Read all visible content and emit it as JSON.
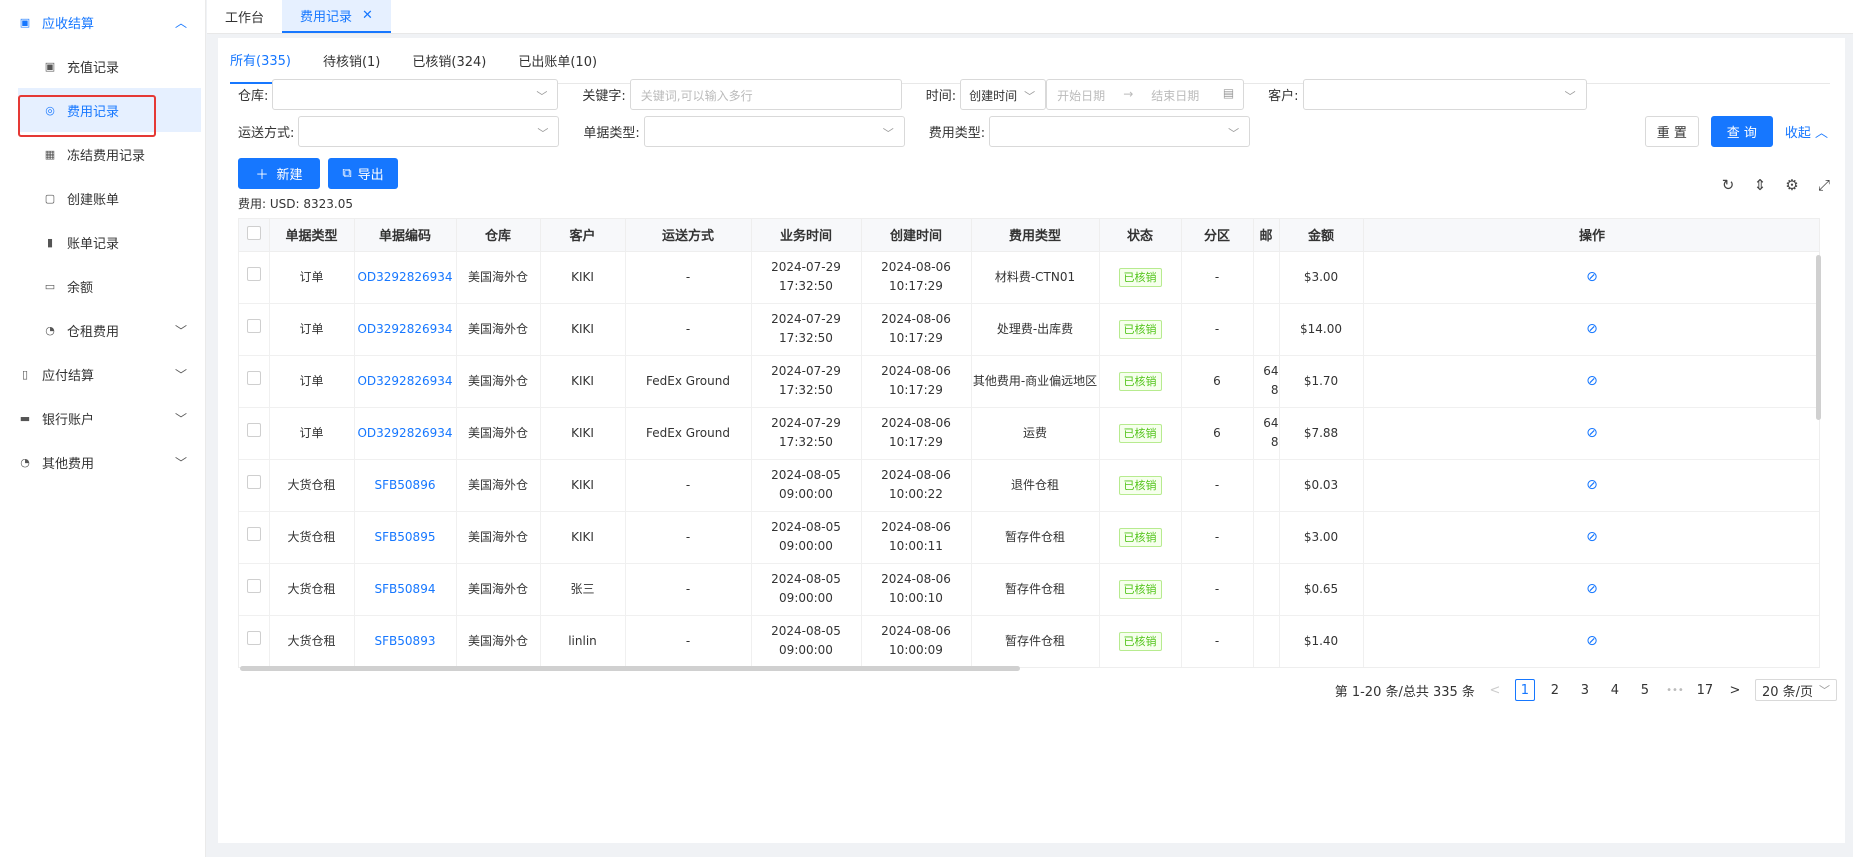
{
  "sidebar": {
    "group1": {
      "label": "应收结算",
      "icon": "ticket-icon"
    },
    "items": [
      {
        "label": "充值记录",
        "icon": "wallet-icon"
      },
      {
        "label": "费用记录",
        "icon": "fee-icon"
      },
      {
        "label": "冻结费用记录",
        "icon": "frozen-icon"
      },
      {
        "label": "创建账单",
        "icon": "file-icon"
      },
      {
        "label": "账单记录",
        "icon": "bill-icon"
      },
      {
        "label": "余额",
        "icon": "balance-icon"
      },
      {
        "label": "仓租费用",
        "icon": "rent-icon"
      }
    ],
    "groups": [
      {
        "label": "应付结算"
      },
      {
        "label": "银行账户"
      },
      {
        "label": "其他费用"
      }
    ]
  },
  "tabs": [
    {
      "label": "工作台"
    },
    {
      "label": "费用记录",
      "close": "✕"
    }
  ],
  "subtabs": [
    {
      "label": "所有(335)"
    },
    {
      "label": "待核销(1)"
    },
    {
      "label": "已核销(324)"
    },
    {
      "label": "已出账单(10)"
    }
  ],
  "filters": {
    "warehouse_label": "仓库:",
    "keyword_label": "关键字:",
    "keyword_placeholder": "关键词,可以输入多行",
    "time_label": "时间:",
    "time_type": "创建时间",
    "start_placeholder": "开始日期",
    "arrow": "→",
    "end_placeholder": "结束日期",
    "customer_label": "客户:",
    "shipping_label": "运送方式:",
    "doc_type_label": "单据类型:",
    "fee_type_label": "费用类型:",
    "reset": "重 置",
    "query": "查 询",
    "collapse": "收起"
  },
  "actions": {
    "new": "新建",
    "export": "导出"
  },
  "summary": "费用: USD: 8323.05",
  "table": {
    "headers": [
      "单据类型",
      "单据编码",
      "仓库",
      "客户",
      "运送方式",
      "业务时间",
      "创建时间",
      "费用类型",
      "状态",
      "分区",
      "邮",
      "金额",
      "操作"
    ],
    "rows": [
      {
        "type": "订单",
        "code": "OD3292826934",
        "wh": "美国海外仓",
        "cust": "KIKI",
        "ship": "-",
        "biz1": "2024-07-29",
        "biz2": "17:32:50",
        "cr1": "2024-08-06",
        "cr2": "10:17:29",
        "fee": "材料费-CTN01",
        "status": "已核销",
        "zone": "-",
        "zip1": "",
        "zip2": "",
        "amt": "$3.00"
      },
      {
        "type": "订单",
        "code": "OD3292826934",
        "wh": "美国海外仓",
        "cust": "KIKI",
        "ship": "-",
        "biz1": "2024-07-29",
        "biz2": "17:32:50",
        "cr1": "2024-08-06",
        "cr2": "10:17:29",
        "fee": "处理费-出库费",
        "status": "已核销",
        "zone": "-",
        "zip1": "",
        "zip2": "",
        "amt": "$14.00"
      },
      {
        "type": "订单",
        "code": "OD3292826934",
        "wh": "美国海外仓",
        "cust": "KIKI",
        "ship": "FedEx Ground",
        "biz1": "2024-07-29",
        "biz2": "17:32:50",
        "cr1": "2024-08-06",
        "cr2": "10:17:29",
        "fee": "其他费用-商业偏远地区",
        "status": "已核销",
        "zone": "6",
        "zip1": "64",
        "zip2": "8",
        "amt": "$1.70"
      },
      {
        "type": "订单",
        "code": "OD3292826934",
        "wh": "美国海外仓",
        "cust": "KIKI",
        "ship": "FedEx Ground",
        "biz1": "2024-07-29",
        "biz2": "17:32:50",
        "cr1": "2024-08-06",
        "cr2": "10:17:29",
        "fee": "运费",
        "status": "已核销",
        "zone": "6",
        "zip1": "64",
        "zip2": "8",
        "amt": "$7.88"
      },
      {
        "type": "大货仓租",
        "code": "SFB50896",
        "wh": "美国海外仓",
        "cust": "KIKI",
        "ship": "-",
        "biz1": "2024-08-05",
        "biz2": "09:00:00",
        "cr1": "2024-08-06",
        "cr2": "10:00:22",
        "fee": "退件仓租",
        "status": "已核销",
        "zone": "-",
        "zip1": "",
        "zip2": "",
        "amt": "$0.03"
      },
      {
        "type": "大货仓租",
        "code": "SFB50895",
        "wh": "美国海外仓",
        "cust": "KIKI",
        "ship": "-",
        "biz1": "2024-08-05",
        "biz2": "09:00:00",
        "cr1": "2024-08-06",
        "cr2": "10:00:11",
        "fee": "暂存件仓租",
        "status": "已核销",
        "zone": "-",
        "zip1": "",
        "zip2": "",
        "amt": "$3.00"
      },
      {
        "type": "大货仓租",
        "code": "SFB50894",
        "wh": "美国海外仓",
        "cust": "张三",
        "ship": "-",
        "biz1": "2024-08-05",
        "biz2": "09:00:00",
        "cr1": "2024-08-06",
        "cr2": "10:00:10",
        "fee": "暂存件仓租",
        "status": "已核销",
        "zone": "-",
        "zip1": "",
        "zip2": "",
        "amt": "$0.65"
      },
      {
        "type": "大货仓租",
        "code": "SFB50893",
        "wh": "美国海外仓",
        "cust": "linlin",
        "ship": "-",
        "biz1": "2024-08-05",
        "biz2": "09:00:00",
        "cr1": "2024-08-06",
        "cr2": "10:00:09",
        "fee": "暂存件仓租",
        "status": "已核销",
        "zone": "-",
        "zip1": "",
        "zip2": "",
        "amt": "$1.40"
      }
    ]
  },
  "pagination": {
    "total_text": "第 1-20 条/总共 335 条",
    "prev": "<",
    "pages": [
      "1",
      "2",
      "3",
      "4",
      "5"
    ],
    "ellipsis": "•••",
    "last": "17",
    "next": ">",
    "page_size": "20 条/页"
  },
  "colors": {
    "primary": "#1677ff",
    "success": "#52c41a",
    "highlight": "#e53935"
  }
}
